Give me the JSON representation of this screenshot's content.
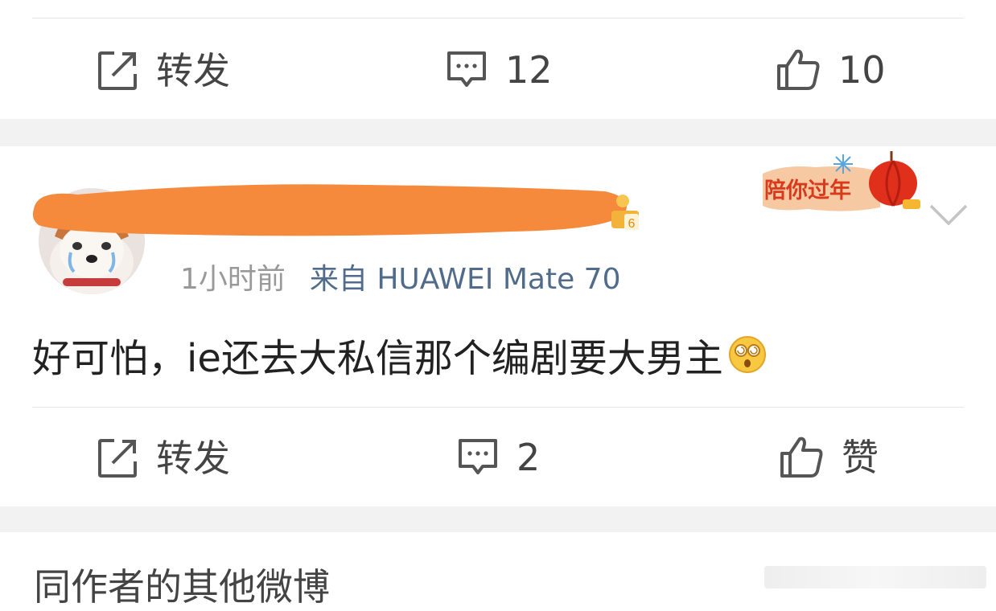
{
  "prev_post": {
    "actions": {
      "repost_label": "转发",
      "comment_count": "12",
      "like_count": "10"
    }
  },
  "post": {
    "timestamp": "1小时前",
    "source": "来自 HUAWEI Mate 70",
    "content": "好可怕，ie还去大私信那个编剧要大男主",
    "festival_badge": "陪你过年",
    "vip_level": "6",
    "actions": {
      "repost_label": "转发",
      "comment_count": "2",
      "like_label": "赞"
    }
  },
  "more_section": {
    "title": "同作者的其他微博"
  },
  "colors": {
    "accent_link": "#516b8b",
    "redaction": "#f58a3d",
    "festival_red": "#d83a1c",
    "gap_gray": "#f2f2f2"
  },
  "icons": [
    "repost-icon",
    "comment-icon",
    "like-icon",
    "chevron-down-icon",
    "dizzy-face-emoji",
    "vip-crown-icon",
    "lantern-icon"
  ]
}
